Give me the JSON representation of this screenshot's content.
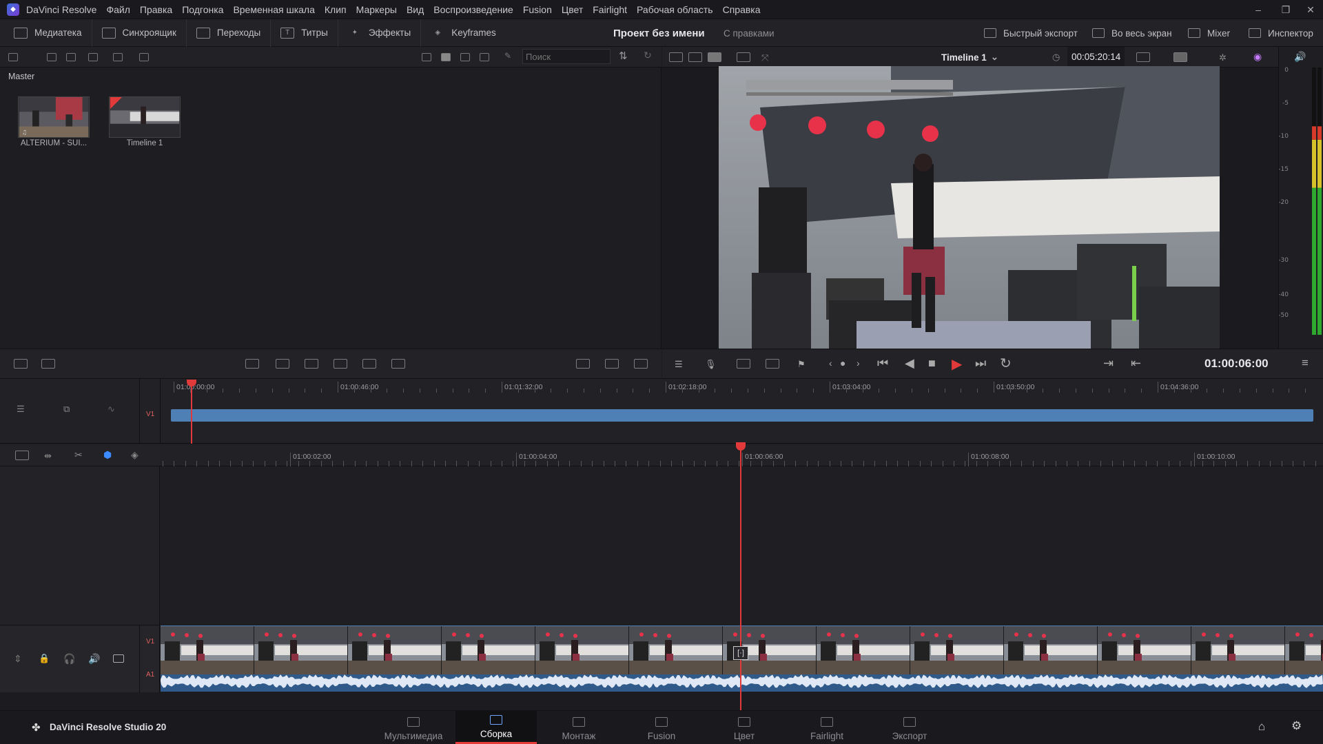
{
  "menubar": {
    "app_name": "DaVinci Resolve",
    "items": [
      "Файл",
      "Правка",
      "Подгонка",
      "Временная шкала",
      "Клип",
      "Маркеры",
      "Вид",
      "Воспроизведение",
      "Fusion",
      "Цвет",
      "Fairlight",
      "Рабочая область",
      "Справка"
    ],
    "window_controls": [
      "–",
      "❐",
      "✕"
    ]
  },
  "toolbar": {
    "left": [
      "Медиатека",
      "Синхроящик",
      "Переходы",
      "Титры",
      "Эффекты",
      "Keyframes"
    ],
    "project_title": "Проект без имени",
    "project_status": "С правками",
    "right": [
      "Быстрый экспорт",
      "Во весь экран",
      "Mixer",
      "Инспектор"
    ]
  },
  "media_pool": {
    "search_placeholder": "Поиск",
    "bin": "Master",
    "clips": [
      {
        "label": "ALTERIUM - SUI..."
      },
      {
        "label": "Timeline 1"
      }
    ]
  },
  "viewer": {
    "timeline_name": "Timeline 1",
    "duration": "00:05:20:14",
    "timecode": "01:00:06:00"
  },
  "audio_meter": {
    "scale": [
      "0",
      "-5",
      "-10",
      "-15",
      "-20",
      "-30",
      "-40",
      "-50"
    ],
    "level": 0.78
  },
  "upper_timeline": {
    "ticks": [
      "01:00:00:00",
      "01:00:46:00",
      "01:01:32:00",
      "01:02:18:00",
      "01:03:04:00",
      "01:03:50:00",
      "01:04:36:00"
    ],
    "track_label": "V1"
  },
  "lower_timeline": {
    "ticks": [
      "01:00:02:00",
      "01:00:04:00",
      "01:00:06:00",
      "01:00:08:00",
      "01:00:10:00"
    ],
    "video_track": "V1",
    "audio_track": "A1"
  },
  "pages": {
    "product": "DaVinci Resolve Studio 20",
    "tabs": [
      "Мультимедиа",
      "Сборка",
      "Монтаж",
      "Fusion",
      "Цвет",
      "Fairlight",
      "Экспорт"
    ],
    "active": "Сборка"
  },
  "colors": {
    "accent_red": "#e23a3a",
    "track_blue": "#4e7fb5",
    "active_icon": "#6ea7ff"
  }
}
